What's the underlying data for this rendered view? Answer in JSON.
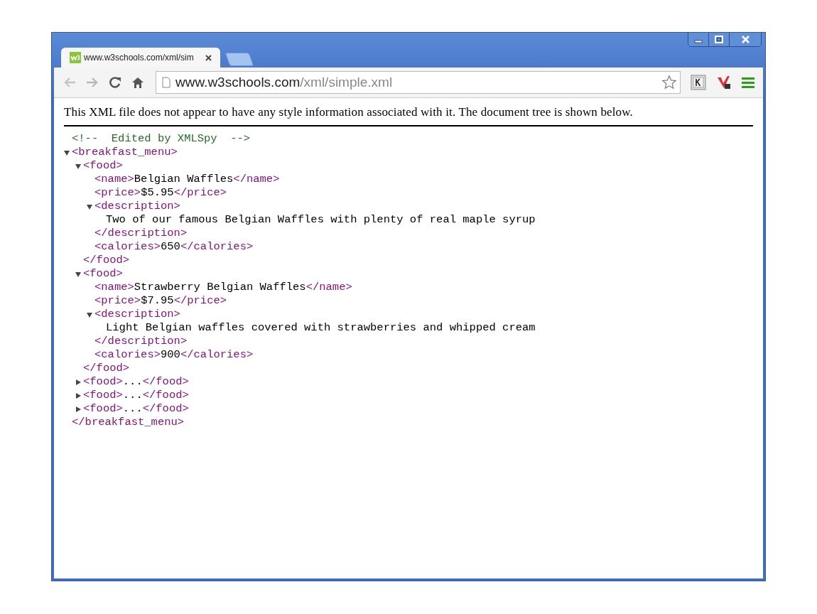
{
  "tab": {
    "title": "www.w3schools.com/xml/sim",
    "selected": true
  },
  "address": {
    "host": "www.w3schools.com",
    "path": "/xml/simple.xml"
  },
  "page": {
    "notice": "This XML file does not appear to have any style information associated with it. The document tree is shown below.",
    "comment": "<!--  Edited by XMLSpy  -->",
    "root": {
      "kind": "element",
      "open_tag": "<breakfast_menu>",
      "close_tag": "</breakfast_menu>",
      "expanded": true,
      "children": [
        {
          "kind": "element",
          "open_tag": "<food>",
          "close_tag": "</food>",
          "expanded": true,
          "children": [
            {
              "kind": "leaf",
              "open_tag": "<name>",
              "text": "Belgian Waffles",
              "close_tag": "</name>"
            },
            {
              "kind": "leaf",
              "open_tag": "<price>",
              "text": "$5.95",
              "close_tag": "</price>"
            },
            {
              "kind": "element",
              "open_tag": "<description>",
              "close_tag": "</description>",
              "expanded": true,
              "children": [
                {
                  "kind": "text",
                  "text": "Two of our famous Belgian Waffles with plenty of real maple syrup"
                }
              ]
            },
            {
              "kind": "leaf",
              "open_tag": "<calories>",
              "text": "650",
              "close_tag": "</calories>"
            }
          ]
        },
        {
          "kind": "element",
          "open_tag": "<food>",
          "close_tag": "</food>",
          "expanded": true,
          "children": [
            {
              "kind": "leaf",
              "open_tag": "<name>",
              "text": "Strawberry Belgian Waffles",
              "close_tag": "</name>"
            },
            {
              "kind": "leaf",
              "open_tag": "<price>",
              "text": "$7.95",
              "close_tag": "</price>"
            },
            {
              "kind": "element",
              "open_tag": "<description>",
              "close_tag": "</description>",
              "expanded": true,
              "children": [
                {
                  "kind": "text",
                  "text": "Light Belgian waffles covered with strawberries and whipped cream"
                }
              ]
            },
            {
              "kind": "leaf",
              "open_tag": "<calories>",
              "text": "900",
              "close_tag": "</calories>"
            }
          ]
        },
        {
          "kind": "element",
          "open_tag": "<food>",
          "close_tag": "</food>",
          "expanded": false,
          "ellipsis": "..."
        },
        {
          "kind": "element",
          "open_tag": "<food>",
          "close_tag": "</food>",
          "expanded": false,
          "ellipsis": "..."
        },
        {
          "kind": "element",
          "open_tag": "<food>",
          "close_tag": "</food>",
          "expanded": false,
          "ellipsis": "..."
        }
      ]
    }
  }
}
